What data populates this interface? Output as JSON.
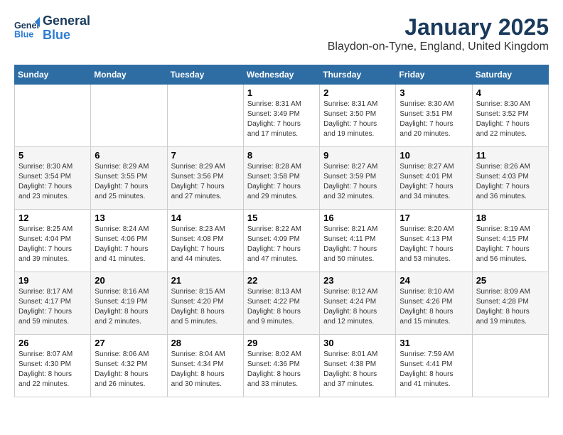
{
  "header": {
    "logo_line1": "General",
    "logo_line2": "Blue",
    "month": "January 2025",
    "location": "Blaydon-on-Tyne, England, United Kingdom"
  },
  "days_of_week": [
    "Sunday",
    "Monday",
    "Tuesday",
    "Wednesday",
    "Thursday",
    "Friday",
    "Saturday"
  ],
  "weeks": [
    [
      {
        "day": "",
        "content": ""
      },
      {
        "day": "",
        "content": ""
      },
      {
        "day": "",
        "content": ""
      },
      {
        "day": "1",
        "content": "Sunrise: 8:31 AM\nSunset: 3:49 PM\nDaylight: 7 hours\nand 17 minutes."
      },
      {
        "day": "2",
        "content": "Sunrise: 8:31 AM\nSunset: 3:50 PM\nDaylight: 7 hours\nand 19 minutes."
      },
      {
        "day": "3",
        "content": "Sunrise: 8:30 AM\nSunset: 3:51 PM\nDaylight: 7 hours\nand 20 minutes."
      },
      {
        "day": "4",
        "content": "Sunrise: 8:30 AM\nSunset: 3:52 PM\nDaylight: 7 hours\nand 22 minutes."
      }
    ],
    [
      {
        "day": "5",
        "content": "Sunrise: 8:30 AM\nSunset: 3:54 PM\nDaylight: 7 hours\nand 23 minutes."
      },
      {
        "day": "6",
        "content": "Sunrise: 8:29 AM\nSunset: 3:55 PM\nDaylight: 7 hours\nand 25 minutes."
      },
      {
        "day": "7",
        "content": "Sunrise: 8:29 AM\nSunset: 3:56 PM\nDaylight: 7 hours\nand 27 minutes."
      },
      {
        "day": "8",
        "content": "Sunrise: 8:28 AM\nSunset: 3:58 PM\nDaylight: 7 hours\nand 29 minutes."
      },
      {
        "day": "9",
        "content": "Sunrise: 8:27 AM\nSunset: 3:59 PM\nDaylight: 7 hours\nand 32 minutes."
      },
      {
        "day": "10",
        "content": "Sunrise: 8:27 AM\nSunset: 4:01 PM\nDaylight: 7 hours\nand 34 minutes."
      },
      {
        "day": "11",
        "content": "Sunrise: 8:26 AM\nSunset: 4:03 PM\nDaylight: 7 hours\nand 36 minutes."
      }
    ],
    [
      {
        "day": "12",
        "content": "Sunrise: 8:25 AM\nSunset: 4:04 PM\nDaylight: 7 hours\nand 39 minutes."
      },
      {
        "day": "13",
        "content": "Sunrise: 8:24 AM\nSunset: 4:06 PM\nDaylight: 7 hours\nand 41 minutes."
      },
      {
        "day": "14",
        "content": "Sunrise: 8:23 AM\nSunset: 4:08 PM\nDaylight: 7 hours\nand 44 minutes."
      },
      {
        "day": "15",
        "content": "Sunrise: 8:22 AM\nSunset: 4:09 PM\nDaylight: 7 hours\nand 47 minutes."
      },
      {
        "day": "16",
        "content": "Sunrise: 8:21 AM\nSunset: 4:11 PM\nDaylight: 7 hours\nand 50 minutes."
      },
      {
        "day": "17",
        "content": "Sunrise: 8:20 AM\nSunset: 4:13 PM\nDaylight: 7 hours\nand 53 minutes."
      },
      {
        "day": "18",
        "content": "Sunrise: 8:19 AM\nSunset: 4:15 PM\nDaylight: 7 hours\nand 56 minutes."
      }
    ],
    [
      {
        "day": "19",
        "content": "Sunrise: 8:17 AM\nSunset: 4:17 PM\nDaylight: 7 hours\nand 59 minutes."
      },
      {
        "day": "20",
        "content": "Sunrise: 8:16 AM\nSunset: 4:19 PM\nDaylight: 8 hours\nand 2 minutes."
      },
      {
        "day": "21",
        "content": "Sunrise: 8:15 AM\nSunset: 4:20 PM\nDaylight: 8 hours\nand 5 minutes."
      },
      {
        "day": "22",
        "content": "Sunrise: 8:13 AM\nSunset: 4:22 PM\nDaylight: 8 hours\nand 9 minutes."
      },
      {
        "day": "23",
        "content": "Sunrise: 8:12 AM\nSunset: 4:24 PM\nDaylight: 8 hours\nand 12 minutes."
      },
      {
        "day": "24",
        "content": "Sunrise: 8:10 AM\nSunset: 4:26 PM\nDaylight: 8 hours\nand 15 minutes."
      },
      {
        "day": "25",
        "content": "Sunrise: 8:09 AM\nSunset: 4:28 PM\nDaylight: 8 hours\nand 19 minutes."
      }
    ],
    [
      {
        "day": "26",
        "content": "Sunrise: 8:07 AM\nSunset: 4:30 PM\nDaylight: 8 hours\nand 22 minutes."
      },
      {
        "day": "27",
        "content": "Sunrise: 8:06 AM\nSunset: 4:32 PM\nDaylight: 8 hours\nand 26 minutes."
      },
      {
        "day": "28",
        "content": "Sunrise: 8:04 AM\nSunset: 4:34 PM\nDaylight: 8 hours\nand 30 minutes."
      },
      {
        "day": "29",
        "content": "Sunrise: 8:02 AM\nSunset: 4:36 PM\nDaylight: 8 hours\nand 33 minutes."
      },
      {
        "day": "30",
        "content": "Sunrise: 8:01 AM\nSunset: 4:38 PM\nDaylight: 8 hours\nand 37 minutes."
      },
      {
        "day": "31",
        "content": "Sunrise: 7:59 AM\nSunset: 4:41 PM\nDaylight: 8 hours\nand 41 minutes."
      },
      {
        "day": "",
        "content": ""
      }
    ]
  ]
}
